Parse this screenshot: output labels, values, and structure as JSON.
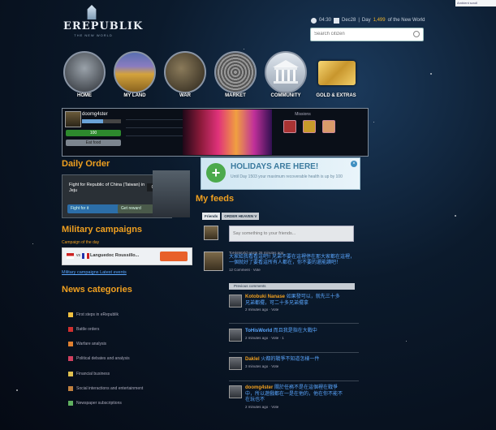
{
  "header": {
    "logo_name": "EREPUBLIK",
    "logo_tagline": "THE NEW WORLD",
    "time": "04:30",
    "date": "Dec28",
    "day_prefix": "Day",
    "day_number": "1,499",
    "day_suffix": "of the New World",
    "search_placeholder": "Search citizen",
    "top_right": "Ambient scroll"
  },
  "nav": [
    {
      "label": "HOME",
      "icon": "soldier-icon"
    },
    {
      "label": "MY LAND",
      "icon": "field-icon"
    },
    {
      "label": "WAR",
      "icon": "battle-icon"
    },
    {
      "label": "MARKET",
      "icon": "crowd-icon"
    },
    {
      "label": "COMMUNITY",
      "icon": "temple-icon"
    },
    {
      "label": "GOLD & EXTRAS",
      "icon": "gold-card-icon"
    }
  ],
  "status": {
    "username": "doomg4ster",
    "level_progress": 0.55,
    "health": "100",
    "eat_button": "Eat food",
    "missions_label": "Missions"
  },
  "daily_order": {
    "title": "Daily Order",
    "text": "Fight for Republic of China (Taiwan) in Jeju",
    "count": "0/25",
    "btn_left": "Fight for it",
    "btn_right": "Get reward"
  },
  "holiday": {
    "title": "HOLIDAYS ARE HERE!",
    "subtitle": "Until Day 1503 your maximum recoverable health is up by 100"
  },
  "feeds": {
    "title": "My feeds",
    "tab1": "Friends",
    "tab2": "ORDER HEAVEN V",
    "say_placeholder": "Say something to your friends...",
    "post_author": "ToHisWorld",
    "post_time": "wrote 26 minutes ago",
    "post_msg": "大家給我看看這吧!! 兄弟不要在這裡停在那大家都在這裡，一個就好了要看這所有人都在，你不要的還能讀吧！",
    "post_meta": "12 Comment · Vote",
    "prev_comments": "Previous comments",
    "comments": [
      {
        "name": "Kotobuki Nanase",
        "text": "如果發可以，就先三十多兄弟都擺，可二十多兄弟擺拿",
        "time": "2 minutes ago · Vote"
      },
      {
        "name": "ToHisWorld",
        "text": "而且我是指在大戰中",
        "time": "2 minutes ago · Vote · 1"
      },
      {
        "name": "Daklel",
        "text": "火都的戰爭不知道怎樣一件",
        "time": "3 minutes ago · Vote"
      },
      {
        "name": "doomg4ster",
        "text": "關於任務不是在這個裡在戰爭中，所以遊戲都在一是在他的，他在你不能不在玩也不",
        "time": "2 minutes ago · Vote"
      }
    ]
  },
  "military": {
    "title": "Military campaigns",
    "campaign_of_day": "Campaign of the day",
    "vs": "vs",
    "battle": "Languedoc Roussillo...",
    "links": "Military campaigns   Latest events"
  },
  "news": {
    "title": "News categories",
    "items": [
      {
        "label": "First steps in eRepublik",
        "color": "#f0c040"
      },
      {
        "label": "Battle orders",
        "color": "#d03030"
      },
      {
        "label": "Warfare analysis",
        "color": "#e08030"
      },
      {
        "label": "Political debates and analysis",
        "color": "#d04060"
      },
      {
        "label": "Financial business",
        "color": "#e0c050"
      },
      {
        "label": "Social interactions and entertainment",
        "color": "#c08040"
      },
      {
        "label": "Newspaper subscriptions",
        "color": "#60b060"
      }
    ]
  }
}
